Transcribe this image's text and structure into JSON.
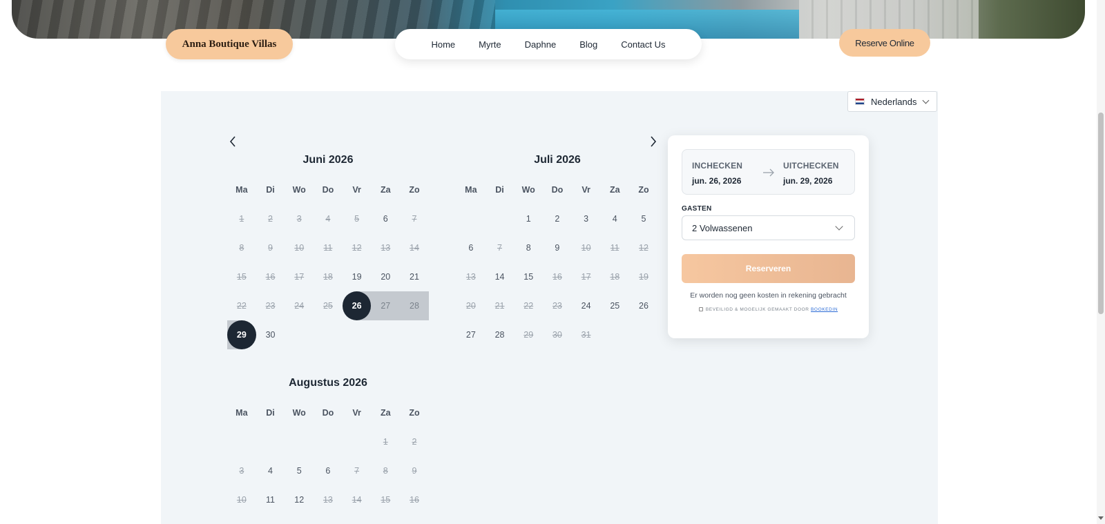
{
  "header": {
    "brand": "Anna Boutique Villas",
    "nav": [
      "Home",
      "Myrte",
      "Daphne",
      "Blog",
      "Contact Us"
    ],
    "reserve_button": "Reserve Online"
  },
  "language": {
    "label": "Nederlands"
  },
  "weekdays": [
    "Ma",
    "Di",
    "Wo",
    "Do",
    "Vr",
    "Za",
    "Zo"
  ],
  "months": [
    {
      "title": "Juni 2026",
      "rows": [
        [
          {
            "d": "1",
            "dis": true
          },
          {
            "d": "2",
            "dis": true
          },
          {
            "d": "3",
            "dis": true
          },
          {
            "d": "4",
            "dis": true
          },
          {
            "d": "5",
            "dis": true
          },
          {
            "d": "6",
            "dis": false
          },
          {
            "d": "7",
            "dis": true
          }
        ],
        [
          {
            "d": "8",
            "dis": true
          },
          {
            "d": "9",
            "dis": true
          },
          {
            "d": "10",
            "dis": true
          },
          {
            "d": "11",
            "dis": true
          },
          {
            "d": "12",
            "dis": true
          },
          {
            "d": "13",
            "dis": true
          },
          {
            "d": "14",
            "dis": true
          }
        ],
        [
          {
            "d": "15",
            "dis": true
          },
          {
            "d": "16",
            "dis": true
          },
          {
            "d": "17",
            "dis": true
          },
          {
            "d": "18",
            "dis": true
          },
          {
            "d": "19",
            "dis": false
          },
          {
            "d": "20",
            "dis": false
          },
          {
            "d": "21",
            "dis": false
          }
        ],
        [
          {
            "d": "22",
            "dis": true
          },
          {
            "d": "23",
            "dis": true
          },
          {
            "d": "24",
            "dis": true
          },
          {
            "d": "25",
            "dis": true
          },
          {
            "d": "26",
            "state": "start"
          },
          {
            "d": "27",
            "state": "range"
          },
          {
            "d": "28",
            "state": "range"
          }
        ],
        [
          {
            "d": "29",
            "state": "end"
          },
          {
            "d": "30",
            "dis": false
          },
          null,
          null,
          null,
          null,
          null
        ]
      ]
    },
    {
      "title": "Juli 2026",
      "rows": [
        [
          null,
          null,
          {
            "d": "1",
            "dis": false
          },
          {
            "d": "2",
            "dis": false
          },
          {
            "d": "3",
            "dis": false
          },
          {
            "d": "4",
            "dis": false
          },
          {
            "d": "5",
            "dis": false
          }
        ],
        [
          {
            "d": "6",
            "dis": false
          },
          {
            "d": "7",
            "dis": true
          },
          {
            "d": "8",
            "dis": false
          },
          {
            "d": "9",
            "dis": false
          },
          {
            "d": "10",
            "dis": true
          },
          {
            "d": "11",
            "dis": true
          },
          {
            "d": "12",
            "dis": true
          }
        ],
        [
          {
            "d": "13",
            "dis": true
          },
          {
            "d": "14",
            "dis": false
          },
          {
            "d": "15",
            "dis": false
          },
          {
            "d": "16",
            "dis": true
          },
          {
            "d": "17",
            "dis": true
          },
          {
            "d": "18",
            "dis": true
          },
          {
            "d": "19",
            "dis": true
          }
        ],
        [
          {
            "d": "20",
            "dis": true
          },
          {
            "d": "21",
            "dis": true
          },
          {
            "d": "22",
            "dis": true
          },
          {
            "d": "23",
            "dis": true
          },
          {
            "d": "24",
            "dis": false
          },
          {
            "d": "25",
            "dis": false
          },
          {
            "d": "26",
            "dis": false
          }
        ],
        [
          {
            "d": "27",
            "dis": false
          },
          {
            "d": "28",
            "dis": false
          },
          {
            "d": "29",
            "dis": true
          },
          {
            "d": "30",
            "dis": true
          },
          {
            "d": "31",
            "dis": true
          },
          null,
          null
        ]
      ]
    },
    {
      "title": "Augustus 2026",
      "rows": [
        [
          null,
          null,
          null,
          null,
          null,
          {
            "d": "1",
            "dis": true
          },
          {
            "d": "2",
            "dis": true
          }
        ],
        [
          {
            "d": "3",
            "dis": true
          },
          {
            "d": "4",
            "dis": false
          },
          {
            "d": "5",
            "dis": false
          },
          {
            "d": "6",
            "dis": false
          },
          {
            "d": "7",
            "dis": true
          },
          {
            "d": "8",
            "dis": true
          },
          {
            "d": "9",
            "dis": true
          }
        ],
        [
          {
            "d": "10",
            "dis": true
          },
          {
            "d": "11",
            "dis": false
          },
          {
            "d": "12",
            "dis": false
          },
          {
            "d": "13",
            "dis": true
          },
          {
            "d": "14",
            "dis": true
          },
          {
            "d": "15",
            "dis": true
          },
          {
            "d": "16",
            "dis": true
          }
        ]
      ]
    }
  ],
  "summary": {
    "checkin_label": "INCHECKEN",
    "checkin_value": "jun. 26, 2026",
    "checkout_label": "UITCHECKEN",
    "checkout_value": "jun. 29, 2026",
    "guests_label": "GASTEN",
    "guests_value": "2 Volwassenen",
    "reserve_button": "Reserveren",
    "note": "Er worden nog geen kosten in rekening gebracht",
    "secure_text": "BEVEILIGD & MOGELIJK GEMAAKT DOOR",
    "secure_link": "BOOKEDIN"
  }
}
